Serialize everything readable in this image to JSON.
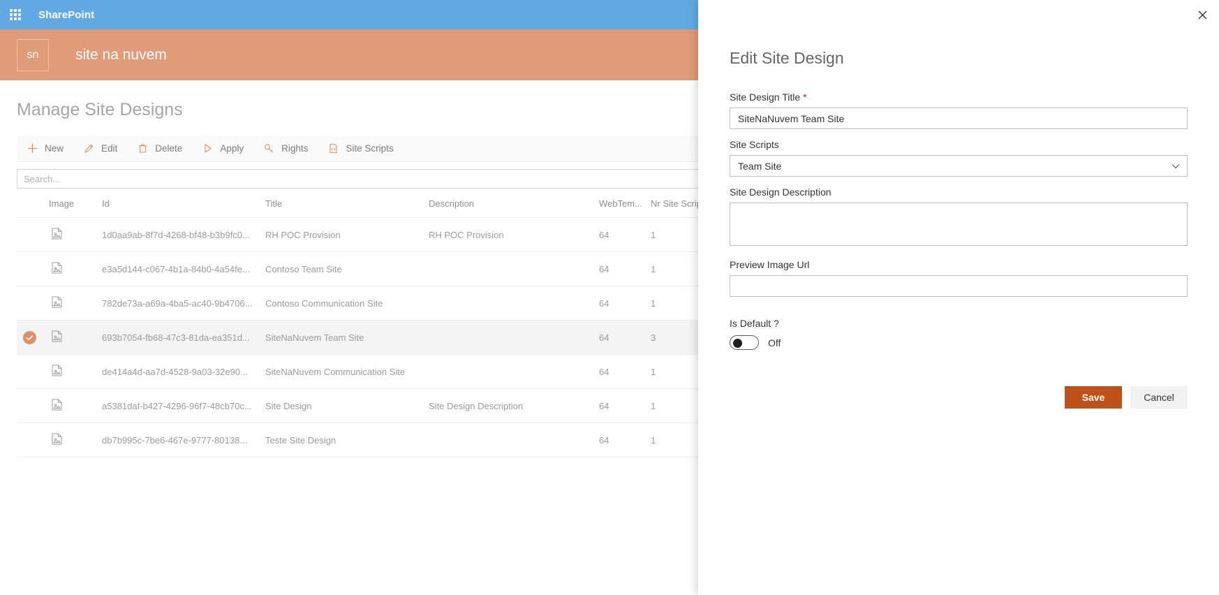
{
  "suite": {
    "waffle_icon": "app-launcher-icon",
    "brand": "SharePoint"
  },
  "site_header": {
    "logo_initials": "sn",
    "site_name": "site na nuvem",
    "background_color": "#e09b79"
  },
  "page": {
    "title": "Manage Site Designs"
  },
  "command_bar": {
    "items": [
      {
        "label": "New",
        "icon": "plus-icon"
      },
      {
        "label": "Edit",
        "icon": "pencil-icon"
      },
      {
        "label": "Delete",
        "icon": "trash-icon"
      },
      {
        "label": "Apply",
        "icon": "play-icon"
      },
      {
        "label": "Rights",
        "icon": "key-icon"
      },
      {
        "label": "Site Scripts",
        "icon": "code-file-icon"
      }
    ]
  },
  "search": {
    "placeholder": "Search...",
    "value": ""
  },
  "table": {
    "columns": [
      "",
      "Image",
      "Id",
      "Title",
      "Description",
      "WebTem...",
      "Nr Site Scripts"
    ],
    "rows": [
      {
        "selected": false,
        "image_icon": "image-file-icon",
        "id": "1d0aa9ab-8f7d-4268-bf48-b3b9fc0...",
        "title": "RH POC Provision",
        "description": "RH POC Provision",
        "webtemplate": "64",
        "nr_site_scripts": "1"
      },
      {
        "selected": false,
        "image_icon": "image-file-icon",
        "id": "e3a5d144-c067-4b1a-84b0-4a54fe...",
        "title": "Contoso Team Site",
        "description": "",
        "webtemplate": "64",
        "nr_site_scripts": "1"
      },
      {
        "selected": false,
        "image_icon": "image-file-icon",
        "id": "782de73a-a69a-4ba5-ac40-9b4706...",
        "title": "Contoso Communication Site",
        "description": "",
        "webtemplate": "64",
        "nr_site_scripts": "1"
      },
      {
        "selected": true,
        "image_icon": "image-file-icon",
        "id": "693b7054-fb68-47c3-81da-ea351d...",
        "title": "SiteNaNuvem Team Site",
        "description": "",
        "webtemplate": "64",
        "nr_site_scripts": "3"
      },
      {
        "selected": false,
        "image_icon": "image-file-icon",
        "id": "de414a4d-aa7d-4528-9a03-32e90...",
        "title": "SiteNaNuvem Communication Site",
        "description": "",
        "webtemplate": "64",
        "nr_site_scripts": "1"
      },
      {
        "selected": false,
        "image_icon": "image-file-icon",
        "id": "a5381daf-b427-4296-96f7-48cb70c...",
        "title": "Site Design",
        "description": "Site Design Description",
        "webtemplate": "64",
        "nr_site_scripts": "1"
      },
      {
        "selected": false,
        "image_icon": "image-file-icon",
        "id": "db7b995c-7be6-467e-9777-80138...",
        "title": "Teste Site Design",
        "description": "",
        "webtemplate": "64",
        "nr_site_scripts": "1"
      }
    ]
  },
  "panel": {
    "close_icon": "close-icon",
    "title": "Edit Site Design",
    "fields": {
      "site_design_title": {
        "label": "Site Design Title",
        "required_marker": "*",
        "value": "SiteNaNuvem Team Site"
      },
      "site_scripts": {
        "label": "Site Scripts",
        "selected": "Team Site",
        "chevron_icon": "chevron-down-icon"
      },
      "site_design_description": {
        "label": "Site Design Description",
        "value": ""
      },
      "preview_image_url": {
        "label": "Preview Image Url",
        "value": ""
      },
      "is_default": {
        "label": "Is Default ?",
        "state": "Off",
        "on": false
      }
    },
    "save_label": "Save",
    "cancel_label": "Cancel",
    "save_color": "#c0501a"
  },
  "colors": {
    "suite_bar": "#62a9e3",
    "site_header": "#e09b79",
    "accent": "#dd8f66",
    "primary_button": "#c0501a"
  }
}
